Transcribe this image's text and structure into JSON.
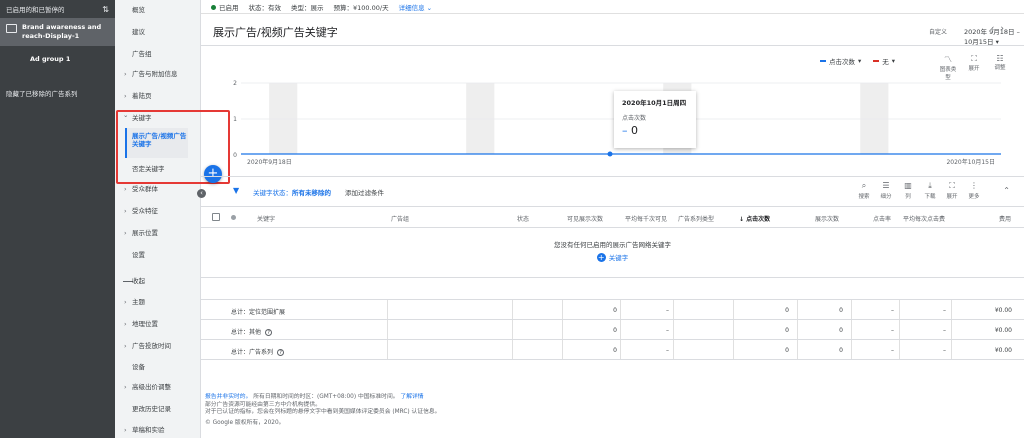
{
  "campaign_panel": {
    "filter_label": "已启用的和已暂停的",
    "sort_icon": "sort-arrows-icon",
    "campaign_name": "Brand awareness and reach-Display-1",
    "ad_group": "Ad group 1",
    "hidden_note": "隐藏了已移除的广告系列"
  },
  "nav": {
    "items": [
      "概览",
      "建议",
      "广告组",
      "广告与附加信息",
      "着陆页",
      "关键字",
      "展示广告/视频广告关键字",
      "否定关键字",
      "受众群体",
      "受众特征",
      "展示位置",
      "设置",
      "收起",
      "主题",
      "地理位置",
      "广告投放时间",
      "设备",
      "高级出价调整",
      "更改历史记录",
      "草稿和实验"
    ]
  },
  "status_bar": {
    "status": "已启用",
    "state_label": "状态：",
    "state_value": "有效",
    "type_label": "类型：",
    "type_value": "展示",
    "budget_label": "预算：",
    "budget_value": "¥100.00/天",
    "details_link": "详细信息"
  },
  "header": {
    "title": "展示广告/视频广告关键字",
    "date_custom": "自定义",
    "date_range": "2020年 9月18日 – 10月15日"
  },
  "chart_tools": {
    "metric1": "点击次数",
    "metric2": "无",
    "icons": [
      "图表类型",
      "展开",
      "调整"
    ]
  },
  "chart_data": {
    "type": "line",
    "x_start": "2020年9月18日",
    "x_end": "2020年10月15日",
    "y_ticks": [
      "2",
      "1",
      "0"
    ],
    "ylim": [
      0,
      2
    ],
    "series": [
      {
        "name": "点击次数",
        "values": [
          0,
          0
        ]
      }
    ],
    "tooltip": {
      "date": "2020年10月1日周四",
      "metric": "点击次数",
      "value": "0"
    },
    "colors": {
      "series": "#1a73e8",
      "weekend_band": "#eeeeee"
    }
  },
  "filter": {
    "label": "关键字状态：",
    "value": "所有未移除的",
    "add": "添加过滤条件"
  },
  "table_tools": [
    "搜索",
    "细分",
    "列",
    "下载",
    "展开",
    "更多"
  ],
  "table": {
    "columns": [
      "关键字",
      "广告组",
      "状态",
      "可见展示次数",
      "平均每千次可见",
      "广告系列类型",
      "点击次数",
      "展示次数",
      "点击率",
      "平均每次点击费",
      "费用"
    ],
    "empty_message": "您没有任何已启用的展示广告网络关键字",
    "add_keyword": "关键字",
    "totals": [
      {
        "label": "总计：定位范围扩展",
        "help": false,
        "vis": "0",
        "vcpm": "–",
        "clicks": "0",
        "impr": "0",
        "ctr": "–",
        "cpc": "–",
        "cost": "¥0.00"
      },
      {
        "label": "总计：其他",
        "help": true,
        "vis": "0",
        "vcpm": "–",
        "clicks": "0",
        "impr": "0",
        "ctr": "–",
        "cpc": "–",
        "cost": "¥0.00"
      },
      {
        "label": "总计：广告系列",
        "help": true,
        "vis": "0",
        "vcpm": "–",
        "clicks": "0",
        "impr": "0",
        "ctr": "–",
        "cpc": "–",
        "cost": "¥0.00"
      }
    ]
  },
  "footer": {
    "report_link": "报告并非实时的。",
    "line1_text": "所有日期和时间的时区：(GMT+08:00) 中国标准时间。",
    "learn_more": "了解详情",
    "line2": "部分广告资源可能经由第三方中介机构提供。",
    "line3": "对于已认证的指标，您会在列标题的悬停文字中看到美国媒体评定委员会 (MRC) 认证信息。",
    "copyright": "© Google 版权所有，2020。"
  }
}
